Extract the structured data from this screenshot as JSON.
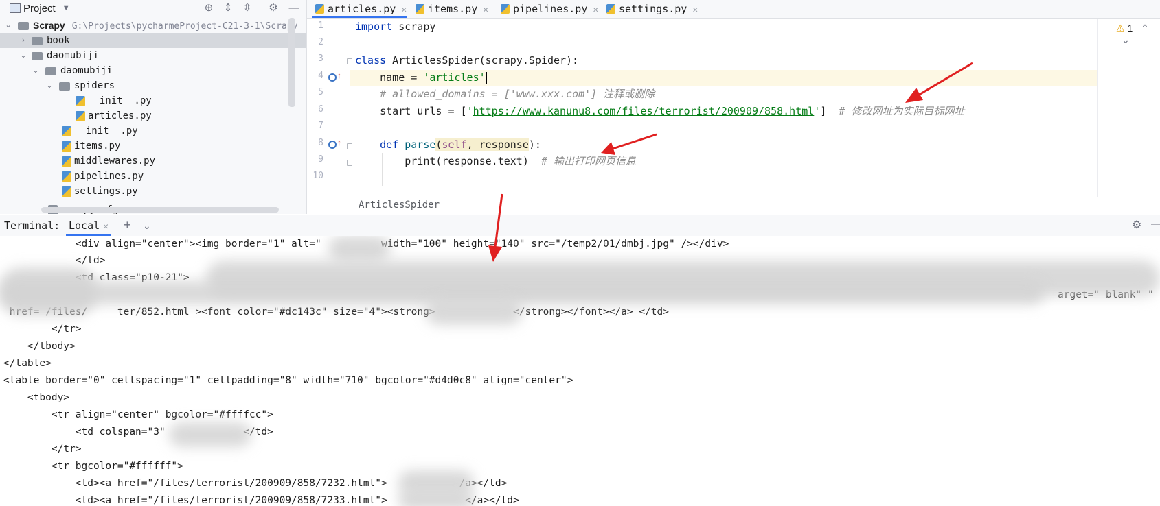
{
  "project": {
    "title": "Project",
    "items": [
      {
        "label": "Scrapy",
        "path": "G:\\Projects\\pycharmeProject-C21-3-1\\Scrapy"
      },
      {
        "label": "book"
      },
      {
        "label": "daomubiji"
      },
      {
        "label": "daomubiji"
      },
      {
        "label": "spiders"
      },
      {
        "label": "__init__.py"
      },
      {
        "label": "articles.py"
      },
      {
        "label": "__init__.py"
      },
      {
        "label": "items.py"
      },
      {
        "label": "middlewares.py"
      },
      {
        "label": "pipelines.py"
      },
      {
        "label": "settings.py"
      },
      {
        "label": "scrapy.cfg"
      }
    ]
  },
  "tabs": [
    {
      "label": "articles.py"
    },
    {
      "label": "items.py"
    },
    {
      "label": "pipelines.py"
    },
    {
      "label": "settings.py"
    }
  ],
  "editor": {
    "line_numbers": [
      "1",
      "2",
      "3",
      "4",
      "5",
      "6",
      "7",
      "8",
      "9",
      "10"
    ],
    "code": {
      "l1_kw": "import",
      "l1_rest": " scrapy",
      "l3_kw": "class",
      "l3_rest": " ArticlesSpider(scrapy.Spider):",
      "l4_a": "    name = ",
      "l4_str": "'articles'",
      "l5_cmt": "    # allowed_domains = ['www.xxx.com'] 注释或删除",
      "l6_a": "    start_urls = [",
      "l6_q1": "'",
      "l6_url": "https://www.kanunu8.com/files/terrorist/200909/858.html",
      "l6_q2": "'",
      "l6_b": "]  ",
      "l6_cmt": "# 修改网址为实际目标网址",
      "l8_a": "    ",
      "l8_kw": "def",
      "l8_sp": " ",
      "l8_fn": "parse",
      "l8_p1": "(",
      "l8_self": "self",
      "l8_p2": ", response",
      "l8_p3": "):",
      "l9_a": "        print(response.text)  ",
      "l9_cmt": "# 输出打印网页信息"
    },
    "warnings": "1",
    "breadcrumb": "ArticlesSpider"
  },
  "terminal": {
    "title": "Terminal:",
    "tab": "Local",
    "lines": [
      "            <div align=\"center\"><img border=\"1\" alt=\"          width=\"100\" height=\"140\" src=\"/temp2/01/dmbj.jpg\" /></div>",
      "            </td>",
      "            <td class=\"p10-21\">",
      "arget=\"_blank\" \"",
      " href= /files/     ter/852.html ><font color=\"#dc143c\" size=\"4\"><strong>             </strong></font></a> </td>",
      "        </tr>",
      "    </tbody>",
      "</table>",
      "<table border=\"0\" cellspacing=\"1\" cellpadding=\"8\" width=\"710\" bgcolor=\"#d4d0c8\" align=\"center\">",
      "    <tbody>",
      "        <tr align=\"center\" bgcolor=\"#ffffcc\">",
      "            <td colspan=\"3\"             </td>",
      "        </tr>",
      "        <tr bgcolor=\"#ffffff\">",
      "            <td><a href=\"/files/terrorist/200909/858/7232.html\">            /a></td>",
      "            <td><a href=\"/files/terrorist/200909/858/7233.html\">             </a></td>"
    ]
  },
  "colors": {
    "accent": "#3574f0",
    "arrow": "#e02020",
    "keyword": "#0033b3",
    "string": "#067d17",
    "comment": "#8c8c8c"
  }
}
